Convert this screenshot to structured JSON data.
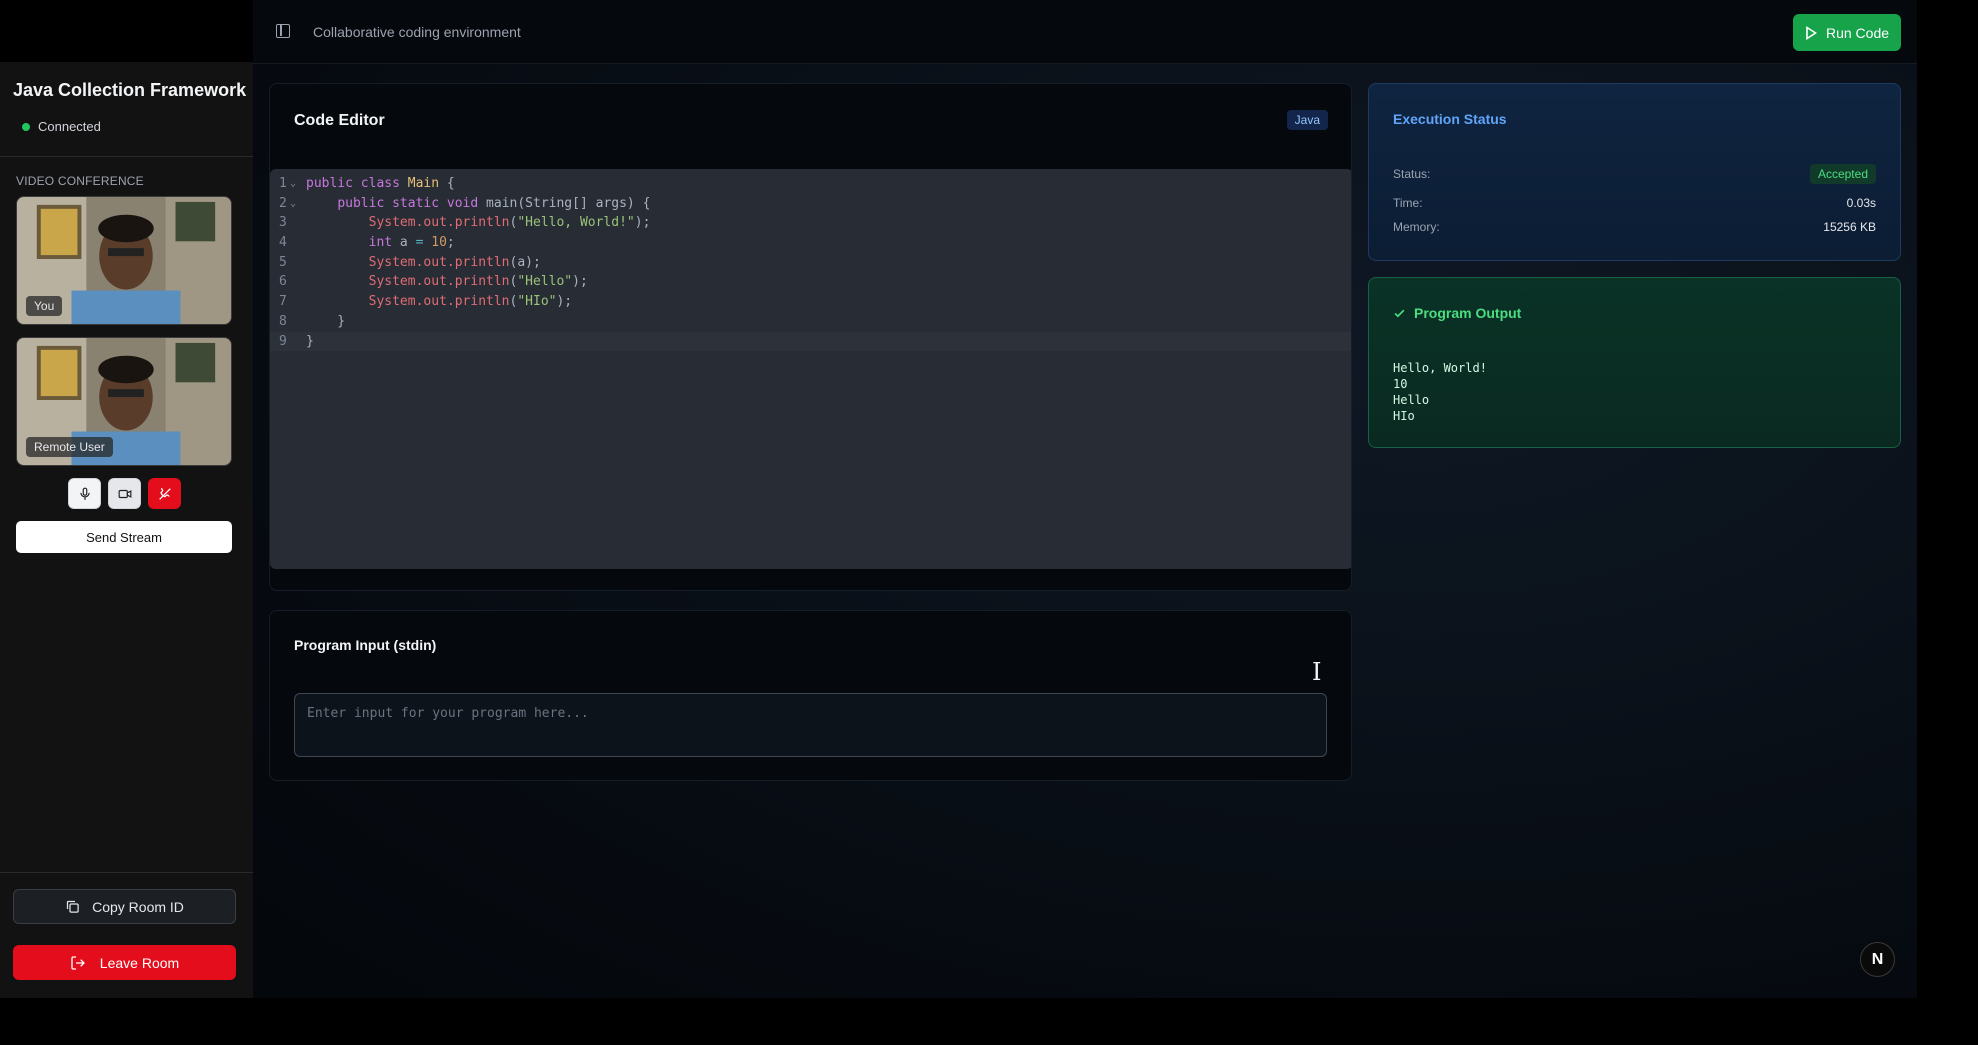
{
  "sidebar": {
    "room_title": "Java Collection Framework",
    "connection_status": "Connected",
    "video_section_label": "VIDEO CONFERENCE",
    "videos": [
      {
        "label": "You"
      },
      {
        "label": "Remote User"
      }
    ],
    "controls": {
      "mic_icon": "mic-icon",
      "camera_icon": "video-camera-icon",
      "end_call_icon": "phone-off-icon"
    },
    "send_stream_label": "Send Stream",
    "copy_room_label": "Copy Room ID",
    "leave_room_label": "Leave Room"
  },
  "header": {
    "subtitle": "Collaborative coding environment",
    "run_label": "Run Code"
  },
  "editor": {
    "title": "Code Editor",
    "language": "Java",
    "lines": [
      "public class Main {",
      "    public static void main(String[] args) {",
      "        System.out.println(\"Hello, World!\");",
      "        int a = 10;",
      "        System.out.println(a);",
      "        System.out.println(\"Hello\");",
      "        System.out.println(\"HIo\");",
      "    }",
      "}"
    ],
    "line_numbers": [
      "1",
      "2",
      "3",
      "4",
      "5",
      "6",
      "7",
      "8",
      "9"
    ]
  },
  "stdin": {
    "title": "Program Input (stdin)",
    "placeholder": "Enter input for your program here...",
    "value": ""
  },
  "execution": {
    "title": "Execution Status",
    "status_label": "Status:",
    "status_value": "Accepted",
    "time_label": "Time:",
    "time_value": "0.03s",
    "memory_label": "Memory:",
    "memory_value": "15256 KB"
  },
  "output": {
    "title": "Program Output",
    "text": "Hello, World!\n10\nHello\nHIo"
  },
  "badge": "N",
  "colors": {
    "accent_green": "#16a34a",
    "danger_red": "#e30d1b",
    "status_blue": "#60a5fa",
    "connected_dot": "#22c55e"
  }
}
